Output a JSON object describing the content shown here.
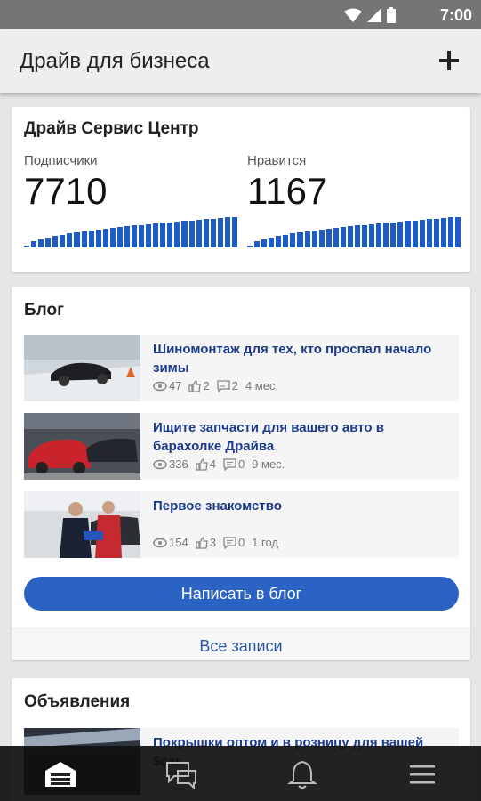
{
  "status_bar": {
    "time": "7:00",
    "icons": [
      "wifi-icon",
      "signal-icon",
      "battery-icon"
    ]
  },
  "app_bar": {
    "title": "Драйв для бизнеса",
    "add_icon": "plus-icon"
  },
  "stats": {
    "name": "Драйв Сервис Центр",
    "subscribers": {
      "label": "Подписчики",
      "value": "7710"
    },
    "likes": {
      "label": "Нравится",
      "value": "1167"
    }
  },
  "blog": {
    "heading": "Блог",
    "posts": [
      {
        "title": "Шиномонтаж для тех, кто проспал начало зимы",
        "views": "47",
        "likes": "2",
        "comments": "2",
        "age": "4 мес."
      },
      {
        "title": "Ищите запчасти для вашего авто в барахолке Драйва",
        "views": "336",
        "likes": "4",
        "comments": "0",
        "age": "9 мес."
      },
      {
        "title": "Первое знакомство",
        "views": "154",
        "likes": "3",
        "comments": "0",
        "age": "1 год"
      }
    ],
    "write_button": "Написать в блог",
    "all_button": "Все записи"
  },
  "ads": {
    "heading": "Объявления",
    "items": [
      {
        "title": "Покрышки оптом и в розницу для вашей $car"
      }
    ]
  },
  "colors": {
    "accent": "#2b63c4",
    "bars": "#1e5bc6",
    "link": "#1c3a8a"
  },
  "nav": [
    "garage-icon",
    "messages-icon",
    "notifications-icon",
    "menu-icon"
  ]
}
